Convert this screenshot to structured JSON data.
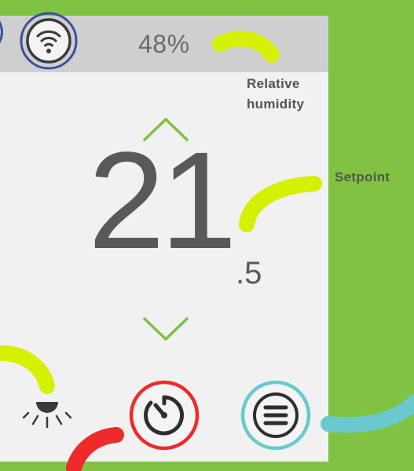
{
  "topbar": {
    "humidity": "48%"
  },
  "setpoint": {
    "integer": "21",
    "decimal": ".5"
  },
  "annotations": {
    "humidity_line1": "Relative",
    "humidity_line2": "humidity",
    "setpoint": "Setpoint"
  },
  "icons": {
    "wifi": "wifi-icon",
    "up": "chevron-up-icon",
    "down": "chevron-down-icon",
    "light": "light-icon",
    "timer": "timer-icon",
    "menu": "menu-icon"
  },
  "colors": {
    "background": "#80c342",
    "panel": "#f1f1f1",
    "topbar": "#cfcfcf",
    "accent_green": "#7cc143",
    "highlight_yellow": "#d5f000",
    "timer_red": "#ee2a2a",
    "menu_teal": "#69c9cf",
    "wifi_blue": "#3a4fa0"
  }
}
